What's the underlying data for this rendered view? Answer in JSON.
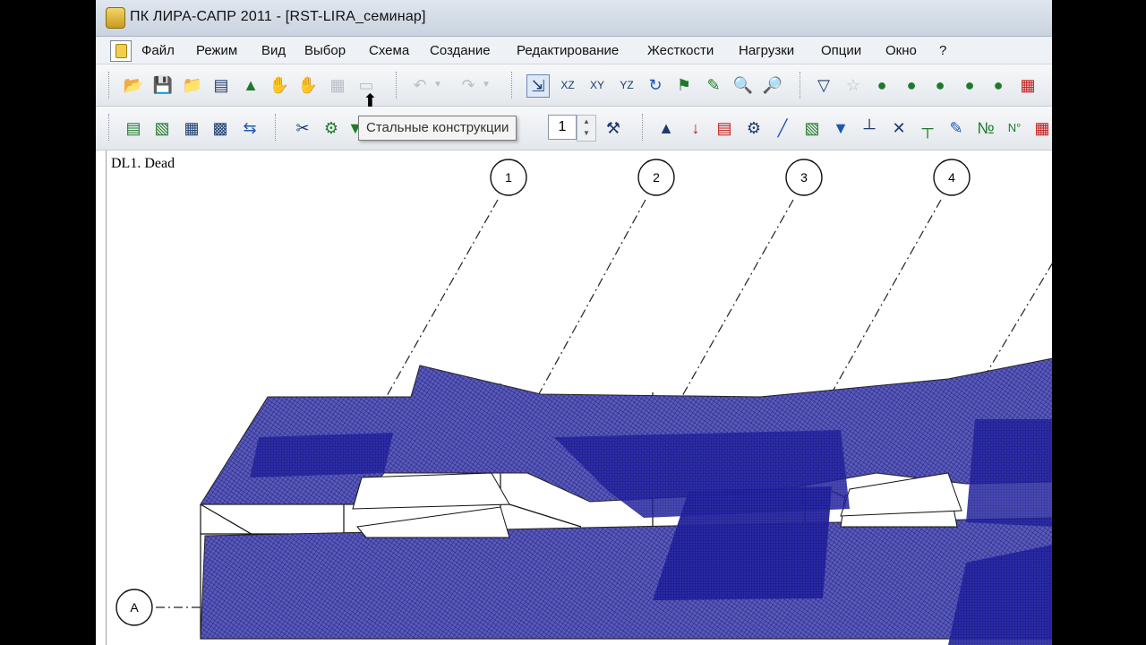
{
  "window": {
    "title": "ПК ЛИРА-САПР  2011 - [RST-LIRA_семинар]"
  },
  "menu": [
    "Файл",
    "Режим",
    "Вид",
    "Выбор",
    "Схема",
    "Создание",
    "Редактирование",
    "Жесткости",
    "Нагрузки",
    "Опции",
    "Окно",
    "?"
  ],
  "toolbar1": {
    "buttons": [
      "open-folder-icon",
      "save-icon",
      "folder-export-icon",
      "text-icon",
      "pin-icon",
      "hand-icon",
      "disabled-hand-icon",
      "disabled-grid-icon",
      "disabled-doc-icon",
      "undo-icon",
      "redo-icon",
      "node-edit-icon",
      "xz-view-icon",
      "xy-view-icon",
      "yz-view-icon",
      "rotate-icon",
      "flag-icon",
      "pencil-icon",
      "zoom-in-icon",
      "zoom-window-icon",
      "filter-icon",
      "disabled-filter-icon",
      "zoom-1-icon",
      "zoom-2-icon",
      "zoom-3-icon",
      "zoom-4-icon",
      "zoom-5-icon",
      "frame-icon"
    ]
  },
  "toolbar2": {
    "spinner_value": "1",
    "tooltip": "Стальные конструкции"
  },
  "canvas": {
    "load_label": "DL1. Dead",
    "grid_axes": [
      "1",
      "2",
      "3",
      "4"
    ],
    "row_axis": "A",
    "mesh_color": "#2a2a8c"
  }
}
